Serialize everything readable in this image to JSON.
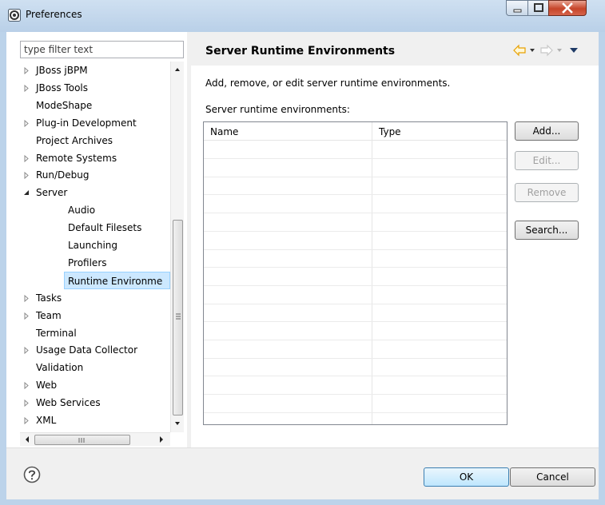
{
  "window": {
    "title": "Preferences"
  },
  "filter": {
    "placeholder": "type filter text"
  },
  "tree": {
    "items": [
      {
        "label": "JBoss jBPM",
        "expander": "collapsed",
        "indent": 0
      },
      {
        "label": "JBoss Tools",
        "expander": "collapsed",
        "indent": 0
      },
      {
        "label": "ModeShape",
        "expander": "none",
        "indent": 0
      },
      {
        "label": "Plug-in Development",
        "expander": "collapsed",
        "indent": 0
      },
      {
        "label": "Project Archives",
        "expander": "none",
        "indent": 0
      },
      {
        "label": "Remote Systems",
        "expander": "collapsed",
        "indent": 0
      },
      {
        "label": "Run/Debug",
        "expander": "collapsed",
        "indent": 0
      },
      {
        "label": "Server",
        "expander": "expanded",
        "indent": 0
      },
      {
        "label": "Audio",
        "expander": "none",
        "indent": 1
      },
      {
        "label": "Default Filesets",
        "expander": "none",
        "indent": 1
      },
      {
        "label": "Launching",
        "expander": "none",
        "indent": 1
      },
      {
        "label": "Profilers",
        "expander": "none",
        "indent": 1
      },
      {
        "label": "Runtime Environme",
        "expander": "none",
        "indent": 1,
        "selected": true
      },
      {
        "label": "Tasks",
        "expander": "collapsed",
        "indent": 0
      },
      {
        "label": "Team",
        "expander": "collapsed",
        "indent": 0
      },
      {
        "label": "Terminal",
        "expander": "none",
        "indent": 0
      },
      {
        "label": "Usage Data Collector",
        "expander": "collapsed",
        "indent": 0
      },
      {
        "label": "Validation",
        "expander": "none",
        "indent": 0
      },
      {
        "label": "Web",
        "expander": "collapsed",
        "indent": 0
      },
      {
        "label": "Web Services",
        "expander": "collapsed",
        "indent": 0
      },
      {
        "label": "XML",
        "expander": "collapsed",
        "indent": 0
      }
    ]
  },
  "page": {
    "title": "Server Runtime Environments",
    "description": "Add, remove, or edit server runtime environments.",
    "list_label": "Server runtime environments:"
  },
  "table": {
    "columns": [
      "Name",
      "Type"
    ],
    "rows": []
  },
  "buttons": {
    "add": "Add...",
    "edit": "Edit...",
    "remove": "Remove",
    "search": "Search...",
    "ok": "OK",
    "cancel": "Cancel"
  },
  "colors": {
    "selection": "#cce8ff",
    "nav_arrow": "#e8a000",
    "title_bar": "#c3d8ed"
  },
  "icons": {
    "back": "back-arrow-icon",
    "forward": "forward-arrow-icon",
    "menu": "view-menu-icon",
    "help": "help-icon"
  }
}
